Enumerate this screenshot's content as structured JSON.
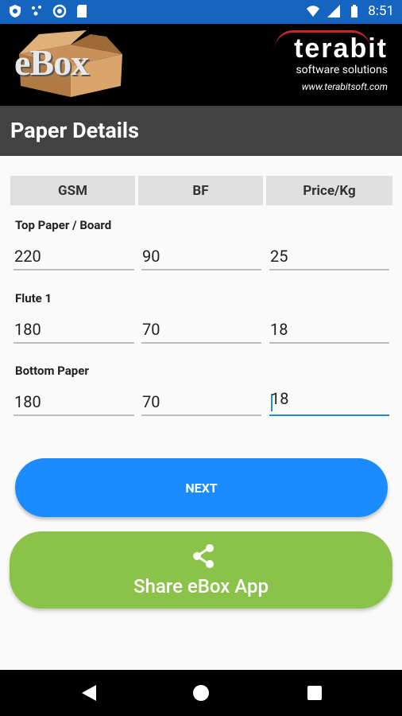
{
  "status_bar": {
    "time": "8:51",
    "icons": [
      "shield-icon",
      "dots-icon",
      "circle-icon",
      "sd-card-icon",
      "wifi-icon",
      "signal-icon",
      "battery-icon"
    ]
  },
  "banner": {
    "app_logo": "eBox",
    "company_name": "terabit",
    "company_tagline": "software solutions",
    "company_url": "www.terabitsoft.com"
  },
  "page": {
    "title": "Paper Details"
  },
  "columns": [
    "GSM",
    "BF",
    "Price/Kg"
  ],
  "rows": [
    {
      "label": "Top Paper / Board",
      "gsm": "220",
      "bf": "90",
      "price": "25"
    },
    {
      "label": "Flute 1",
      "gsm": "180",
      "bf": "70",
      "price": "18"
    },
    {
      "label": "Bottom Paper",
      "gsm": "180",
      "bf": "70",
      "price": "18"
    }
  ],
  "buttons": {
    "next": "NEXT",
    "share": "Share eBox App"
  },
  "colors": {
    "status_bar": "#1565c0",
    "title_bar": "#424242",
    "next_button": "#1a8cff",
    "share_button": "#8bc34a",
    "active_underline": "#1e88e5"
  }
}
